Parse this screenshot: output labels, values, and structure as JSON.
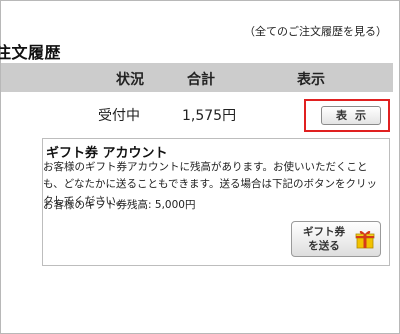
{
  "header": {
    "all_orders_link": "（全てのご注文履歴を見る）",
    "section_title": "注文履歴"
  },
  "orders_table": {
    "columns": [
      "状況",
      "合計",
      "表示"
    ],
    "rows": [
      {
        "status": "受付中",
        "total": "1,575円",
        "view_label": "表示"
      }
    ]
  },
  "gift_account": {
    "title": "ギフト券 アカウント",
    "description": "お客様のギフト券アカウントに残高があります。お使いいただくことも、どなたかに送ることもできます。送る場合は下記のボタンをクリックしてください。",
    "balance_label": "お客様のギフト券残高:",
    "balance_value": "5,000円",
    "send_button_label": "ギフト券\nを送る",
    "send_button_icon": "gift-box-icon"
  },
  "colors": {
    "header_bg": "#cccccc",
    "highlight_border": "#e02020",
    "gift_icon_yellow": "#f2c200",
    "gift_icon_red": "#d43a1a"
  }
}
